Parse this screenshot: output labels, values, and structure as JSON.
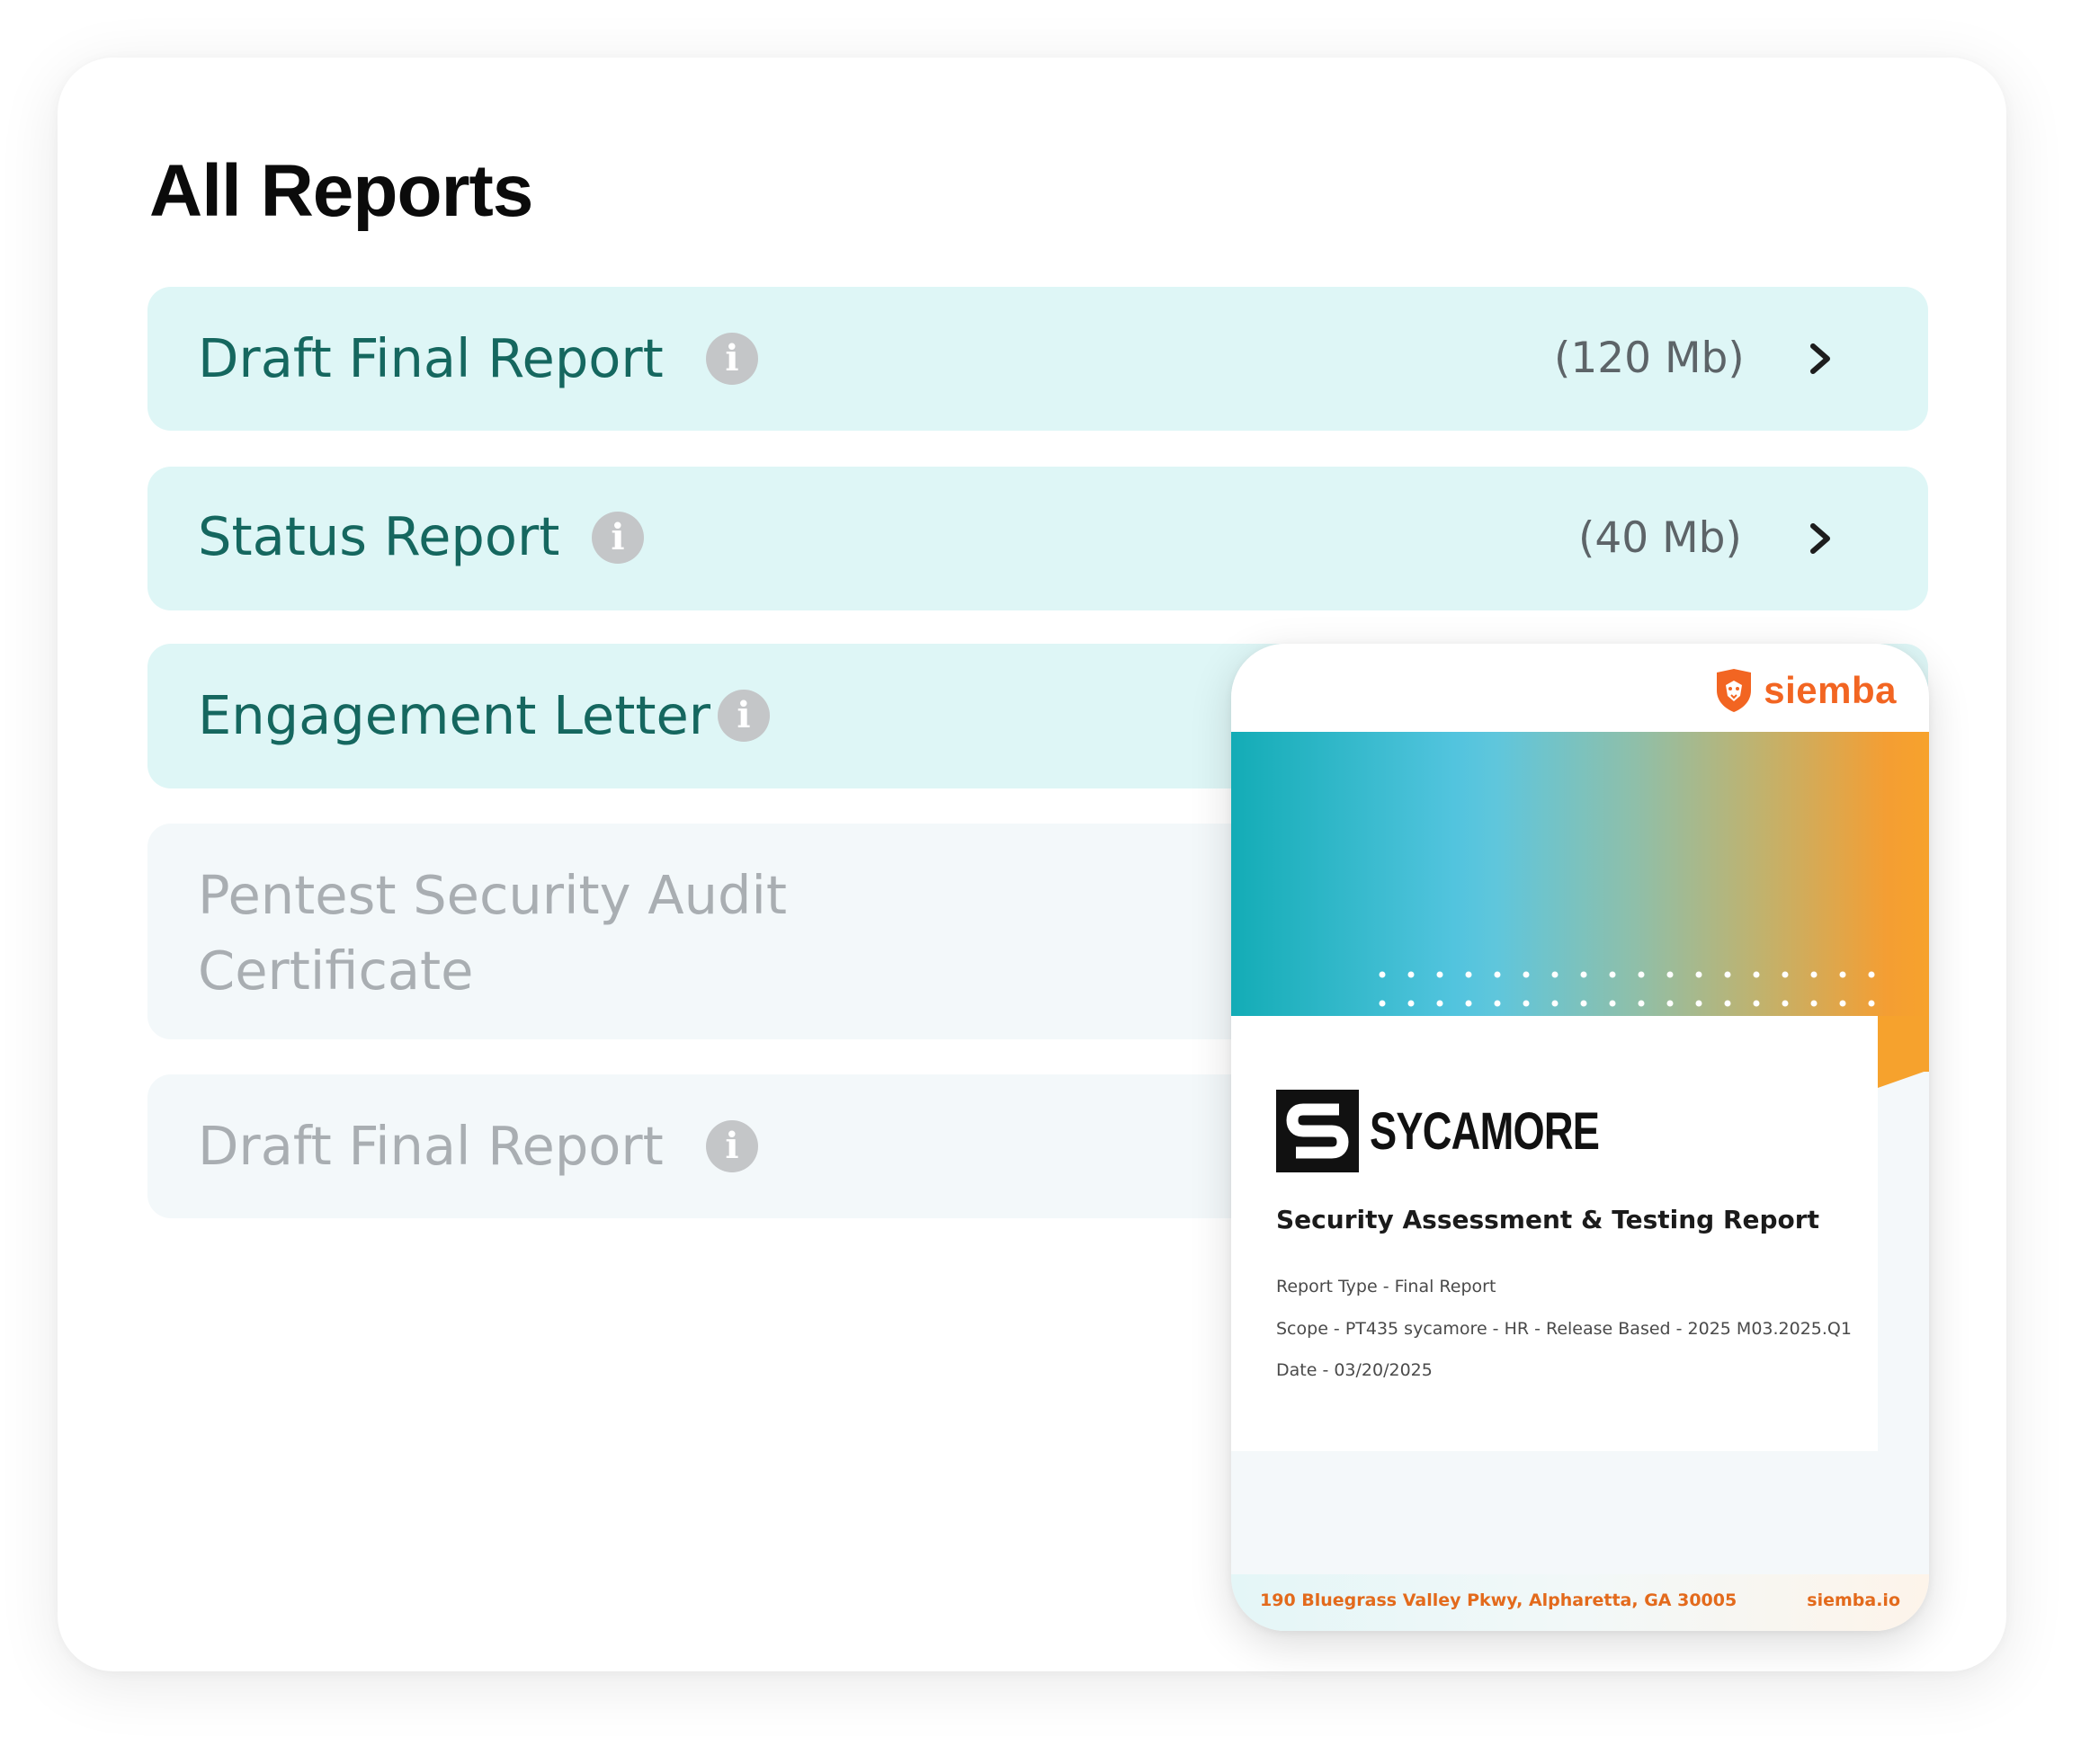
{
  "page_title": "All Reports",
  "reports": [
    {
      "title": "Draft Final Report",
      "size": "(120 Mb)",
      "state": "available"
    },
    {
      "title": "Status Report",
      "size": "(40 Mb)",
      "state": "available"
    },
    {
      "title": "Engagement Letter",
      "state": "available"
    },
    {
      "title_line1": "Pentest Security Audit",
      "title_line2": "Certificate",
      "state": "disabled"
    },
    {
      "title": "Draft Final Report",
      "state": "disabled"
    }
  ],
  "preview": {
    "brand": "siemba",
    "client_name": "SYCAMORE",
    "heading": "Security Assessment & Testing Report",
    "report_type": "Report Type - Final Report",
    "scope": "Scope - PT435 sycamore - HR - Release Based - 2025 M03.2025.Q1",
    "date": "Date - 03/20/2025",
    "address": "190 Bluegrass Valley Pkwy, Alpharetta, GA 30005",
    "website": "siemba.io"
  },
  "colors": {
    "row_active_bg": "#def6f6",
    "row_title_active": "#15675f",
    "row_disabled_bg": "#f3f8fa",
    "row_title_disabled": "#a9aeb2",
    "brand_orange": "#f26522"
  },
  "icons": {
    "info": "info-icon",
    "chevron": "chevron-right-icon",
    "brand": "lion-shield-icon"
  }
}
